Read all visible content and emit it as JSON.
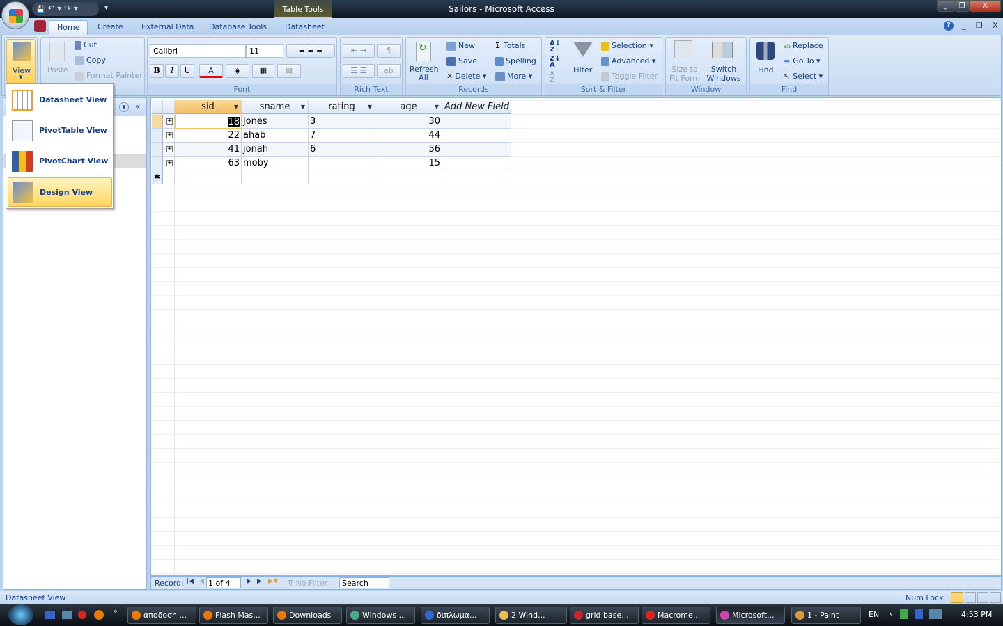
{
  "window": {
    "title": "Sailors - Microsoft Access",
    "context_tab": "Table Tools",
    "minimize": "_",
    "restore": "❐",
    "close": "X"
  },
  "quick_access": {
    "save": "💾",
    "undo": "↶ ▾",
    "redo": "↷ ▾",
    "customize": "▾"
  },
  "tabs": [
    {
      "label": "Home",
      "active": true
    },
    {
      "label": "Create"
    },
    {
      "label": "External Data"
    },
    {
      "label": "Database Tools"
    },
    {
      "label": "Datasheet"
    }
  ],
  "help": {
    "icon": "?",
    "min": "_",
    "restore": "❐",
    "close": "X"
  },
  "ribbon": {
    "views": {
      "view": "View"
    },
    "clipboard": {
      "paste": "Paste",
      "cut": "Cut",
      "copy": "Copy",
      "format_painter": "Format Painter"
    },
    "font": {
      "label": "Font",
      "font_name": "Calibri",
      "font_size": "11",
      "bold": "B",
      "italic": "I",
      "underline": "U",
      "font_color": "A"
    },
    "rich_text": {
      "label": "Rich Text"
    },
    "records": {
      "label": "Records",
      "refresh": "Refresh All",
      "new": "New",
      "save": "Save",
      "delete": "Delete",
      "totals": "Totals",
      "spelling": "Spelling",
      "more": "More"
    },
    "sort_filter": {
      "label": "Sort & Filter",
      "filter": "Filter",
      "selection": "Selection",
      "advanced": "Advanced",
      "toggle_filter": "Toggle Filter"
    },
    "window": {
      "label": "Window",
      "size_to_fit": "Size to Fit Form",
      "switch_windows": "Switch Windows"
    },
    "find": {
      "label": "Find",
      "find": "Find",
      "replace": "Replace",
      "go_to": "Go To",
      "select": "Select"
    }
  },
  "view_menu": [
    {
      "label": "Datasheet View"
    },
    {
      "label": "PivotTable View"
    },
    {
      "label": "PivotChart View"
    },
    {
      "label": "Design View",
      "highlighted": true
    }
  ],
  "table": {
    "columns": [
      "sid",
      "sname",
      "rating",
      "age",
      "Add New Field"
    ],
    "rows": [
      {
        "sid": "18",
        "sname": "jones",
        "rating": "3",
        "age": "30"
      },
      {
        "sid": "22",
        "sname": "ahab",
        "rating": "7",
        "age": "44"
      },
      {
        "sid": "41",
        "sname": "jonah",
        "rating": "6",
        "age": "56"
      },
      {
        "sid": "63",
        "sname": "moby",
        "rating": "",
        "age": "15"
      }
    ],
    "new_row_marker": "✱"
  },
  "record_nav": {
    "label": "Record:",
    "position": "1 of 4",
    "filter": "No Filter",
    "search": "Search"
  },
  "status": {
    "left": "Datasheet View",
    "num_lock": "Num Lock"
  },
  "taskbar": {
    "items": [
      "αποδοση ...",
      "Flash Mas...",
      "Downloads",
      "Windows ...",
      "διπλωμα...",
      "2 Wind...",
      "grid base...",
      "Macrome...",
      "Microsoft...",
      "1 - Paint"
    ],
    "lang": "EN",
    "clock": "4:53 PM"
  }
}
